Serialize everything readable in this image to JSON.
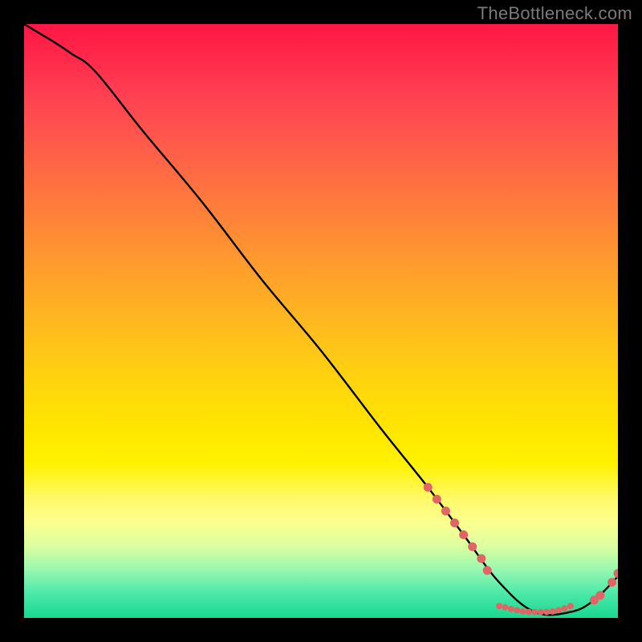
{
  "watermark": "TheBottleneck.com",
  "chart_data": {
    "type": "line",
    "title": "",
    "xlabel": "",
    "ylabel": "",
    "xlim": [
      0,
      100
    ],
    "ylim": [
      0,
      100
    ],
    "series": [
      {
        "name": "curve",
        "x": [
          0,
          5,
          8,
          12,
          20,
          30,
          40,
          50,
          60,
          68,
          74,
          80,
          86,
          92,
          96,
          100
        ],
        "y": [
          100,
          97,
          95,
          92,
          82,
          70,
          57,
          45,
          32,
          22,
          14,
          6,
          1,
          1,
          3,
          7
        ]
      }
    ],
    "markers": [
      {
        "group": "descent",
        "points": [
          {
            "x": 68.0,
            "y": 22.0
          },
          {
            "x": 69.5,
            "y": 20.0
          },
          {
            "x": 71.0,
            "y": 18.0
          },
          {
            "x": 72.5,
            "y": 16.0
          },
          {
            "x": 74.0,
            "y": 14.0
          },
          {
            "x": 75.5,
            "y": 12.0
          },
          {
            "x": 77.0,
            "y": 10.0
          },
          {
            "x": 78.0,
            "y": 8.0
          }
        ]
      },
      {
        "group": "valley",
        "points": [
          {
            "x": 80.0,
            "y": 2.0
          },
          {
            "x": 81.0,
            "y": 1.8
          },
          {
            "x": 82.0,
            "y": 1.5
          },
          {
            "x": 83.0,
            "y": 1.3
          },
          {
            "x": 84.0,
            "y": 1.1
          },
          {
            "x": 85.0,
            "y": 1.0
          },
          {
            "x": 86.0,
            "y": 1.0
          },
          {
            "x": 87.0,
            "y": 1.0
          },
          {
            "x": 88.0,
            "y": 1.0
          },
          {
            "x": 89.0,
            "y": 1.1
          },
          {
            "x": 90.0,
            "y": 1.3
          },
          {
            "x": 91.0,
            "y": 1.6
          },
          {
            "x": 92.0,
            "y": 2.0
          }
        ]
      },
      {
        "group": "tail",
        "points": [
          {
            "x": 96.0,
            "y": 3.0
          },
          {
            "x": 97.0,
            "y": 3.8
          },
          {
            "x": 99.0,
            "y": 6.0
          },
          {
            "x": 100.0,
            "y": 7.5
          }
        ]
      }
    ],
    "marker_color": "#e06666",
    "curve_color": "#000000",
    "background_gradient": {
      "top": "#ff1744",
      "mid": "#ffd40f",
      "bottom": "#18d890"
    }
  }
}
